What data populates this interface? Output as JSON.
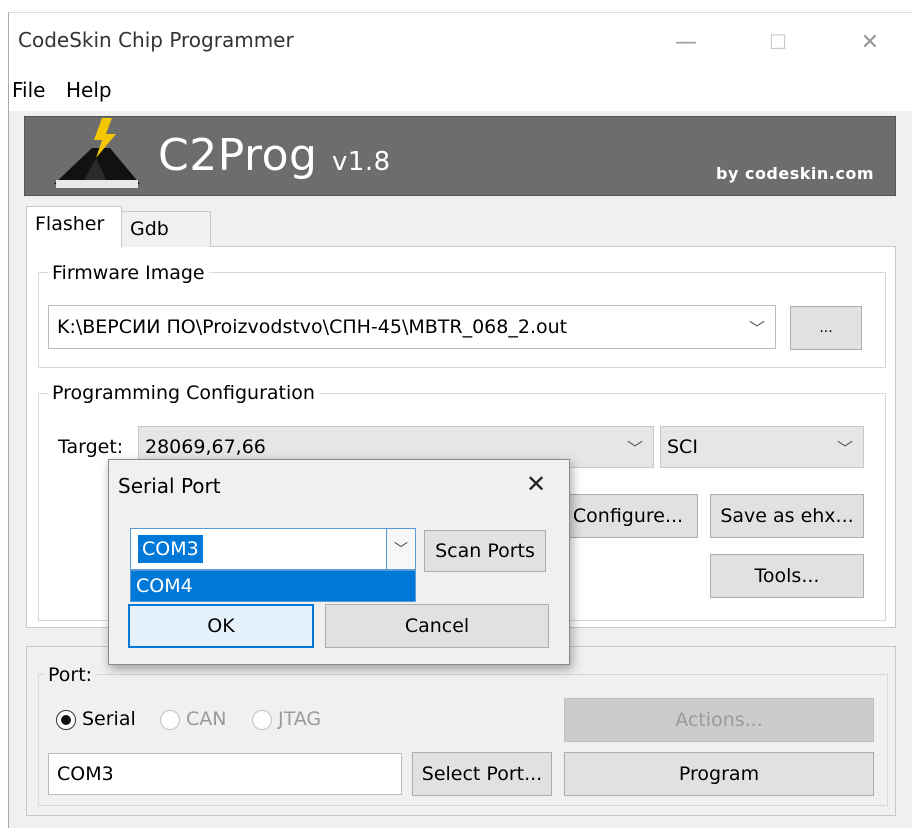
{
  "window": {
    "title": "CodeSkin Chip Programmer",
    "minimize_glyph": "—",
    "maximize_glyph": "☐",
    "close_glyph": "✕"
  },
  "menu": {
    "items": [
      "File",
      "Help"
    ]
  },
  "banner": {
    "title": "C2Prog",
    "version": "v1.8",
    "byline": "by codeskin.com",
    "colors": {
      "background": "#6d6d6d",
      "bolt": "#f2c600"
    }
  },
  "tabs": [
    {
      "label": "Flasher",
      "active": true
    },
    {
      "label": "Gdb",
      "active": false
    }
  ],
  "firmware": {
    "group_label": "Firmware Image",
    "path": "K:\\ВЕРСИИ ПО\\Proizvodstvo\\СПН-45\\MBTR_068_2.out",
    "browse_label": "..."
  },
  "programming": {
    "group_label": "Programming Configuration",
    "target_label": "Target:",
    "target_value": "28069,67,66",
    "interface_value": "SCI",
    "configure_label": "Configure...",
    "save_label": "Save as ehx...",
    "tools_label": "Tools..."
  },
  "port": {
    "group_label": "Port:",
    "options": [
      {
        "label": "Serial",
        "selected": true,
        "enabled": true
      },
      {
        "label": "CAN",
        "selected": false,
        "enabled": false
      },
      {
        "label": "JTAG",
        "selected": false,
        "enabled": false
      }
    ],
    "value": "COM3",
    "select_label": "Select Port...",
    "actions_label": "Actions...",
    "program_label": "Program"
  },
  "dialog": {
    "title": "Serial Port",
    "close_glyph": "✕",
    "selected_port": "COM3",
    "dropdown_options": [
      "COM4"
    ],
    "scan_label": "Scan Ports",
    "ok_label": "OK",
    "cancel_label": "Cancel",
    "colors": {
      "highlight": "#0078d7"
    }
  },
  "icons": [
    "chevron-down-icon",
    "close-icon",
    "minimize-icon",
    "maximize-icon",
    "radio-icon",
    "c2prog-logo-icon"
  ]
}
